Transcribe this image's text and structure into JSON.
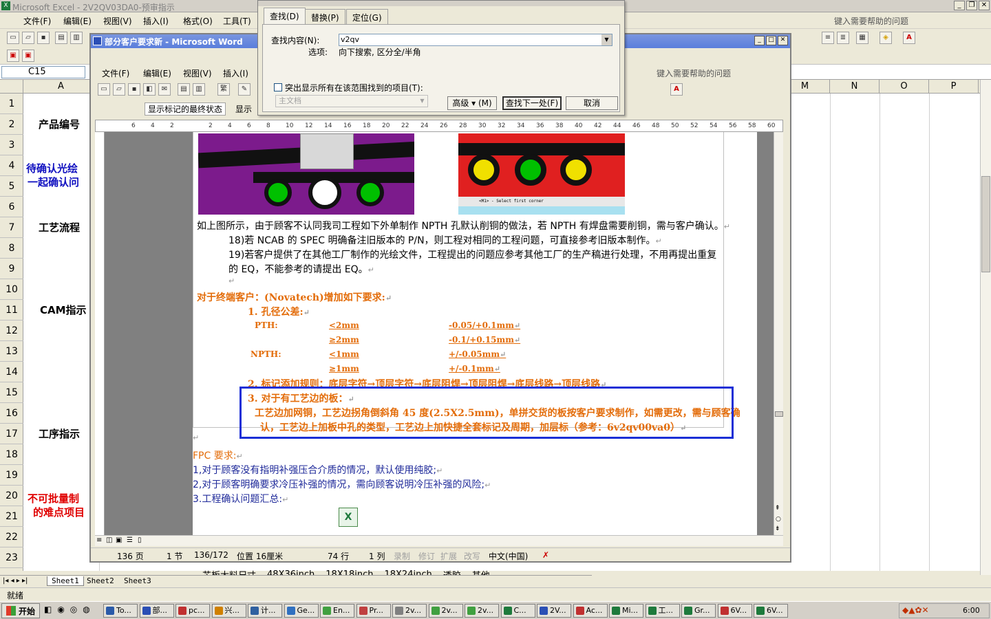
{
  "excel": {
    "title": "Microsoft Excel - 2V2QV03DA0-预审指示",
    "menu": [
      "文件(F)",
      "编辑(E)",
      "视图(V)",
      "插入(I)",
      "格式(O)",
      "工具(T)"
    ],
    "help_placeholder": "键入需要帮助的问题",
    "name_box": "C15",
    "col_a": "A",
    "cols_right": [
      "M",
      "N",
      "O",
      "P"
    ],
    "rows": [
      "1",
      "2",
      "3",
      "4",
      "5",
      "6",
      "7",
      "8",
      "9",
      "10",
      "11",
      "12",
      "13",
      "14",
      "15",
      "16",
      "17",
      "18",
      "19",
      "20",
      "21",
      "22",
      "23"
    ],
    "cells": {
      "product_no": "产品编号",
      "confirm_1": "待确认光绘",
      "confirm_2": "一起确认问",
      "process_flow": "工艺流程",
      "cam": "CAM指示",
      "procedure": "工序指示",
      "hard_1": "不可批量制",
      "hard_2": "的难点项目"
    },
    "bottom_row_text": "芯板大料尺寸",
    "bottom_opts": [
      "48X36inch",
      "18X18inch",
      "18X24inch",
      "透胶",
      "其他"
    ],
    "sheets": [
      "Sheet1",
      "Sheet2",
      "Sheet3"
    ],
    "status": "就绪"
  },
  "word": {
    "title": "部分客户要求新 - Microsoft Word",
    "menu": [
      "文件(F)",
      "编辑(E)",
      "视图(V)",
      "插入(I)"
    ],
    "help_placeholder": "键入需要帮助的问题",
    "markup_select": "显示标记的最终状态",
    "show_label": "显示",
    "ruler": [
      "6",
      "4",
      "2",
      "",
      "2",
      "4",
      "6",
      "8",
      "10",
      "12",
      "14",
      "16",
      "18",
      "20",
      "22",
      "24",
      "26",
      "28",
      "30",
      "32",
      "34",
      "36",
      "38",
      "40",
      "42",
      "44",
      "46",
      "48",
      "50",
      "52",
      "54",
      "56",
      "58",
      "60"
    ],
    "document": {
      "para_npth": "如上图所示，由于顾客不认同我司工程如下外单制作 NPTH 孔默认削铜的做法，若 NPTH 有焊盘需要削铜，需与客户确认。",
      "item18": "18)若 NCAB 的 SPEC 明确备注旧版本的 P/N，则工程对相同的工程问题，可直接参考旧版本制作。",
      "item19a": "19)若客户提供了在其他工厂制作的光绘文件，工程提出的问题应参考其他工厂的生产稿进行处理，不用再提出重复",
      "item19b": "的 EQ，不能参考的请提出 EQ。",
      "novatech": "对于终端客户：(Novatech)增加如下要求:",
      "hole_title": "1.  孔径公差:",
      "pth": "PTH:",
      "npth": "NPTH:",
      "pth_r1": "<2mm",
      "pth_t1": "-0.05/+0.1mm",
      "pth_r2": "≥2mm",
      "pth_t2": "-0.1/+0.15mm",
      "npth_r1": "<1mm",
      "npth_t1": "+/-0.05mm",
      "npth_r2": "≥1mm",
      "npth_t2": "+/-0.1mm",
      "marking": "2.  标记添加规则：底层字符→顶层字符→底层阻焊→顶层阻焊→底层线路→顶层线路",
      "edge_title": "3.  对于有工艺边的板：",
      "edge_l1": "工艺边加网铜，工艺边拐角倒斜角 45 度(2.5X2.5mm)，单拼交货的板按客户要求制作，如需更改，需与顾客确",
      "edge_l2": "认，工艺边上加板中孔的类型，工艺边上加快捷全套标记及周期，加层标（参考：6v2qv00va0）",
      "fpc_title": "FPC 要求:",
      "fpc1": "1,对于顾客没有指明补强压合介质的情况，默认使用纯胶;",
      "fpc2": "2,对于顾客明确要求冷压补强的情况，需向顾客说明冷压补强的风险;",
      "fpc3": "3.工程确认问题汇总:"
    },
    "screenshot_right_caption": "<M1> - Select first corner",
    "status": {
      "page": "136 页",
      "section": "1 节",
      "pages": "136/172",
      "position": "位置 16厘米",
      "line": "74 行",
      "col": "1 列",
      "rec": "录制",
      "trk": "修订",
      "ext": "扩展",
      "ovr": "改写",
      "lang": "中文(中国)"
    }
  },
  "find_dialog": {
    "tabs": [
      "查找(D)",
      "替换(P)",
      "定位(G)"
    ],
    "find_label": "查找内容(N):",
    "find_value": "v2qv",
    "options_label": "选项:",
    "options_value": "向下搜索, 区分全/半角",
    "highlight_label": "突出显示所有在该范围找到的项目(T):",
    "scope": "主文档",
    "btn_more": "高级 ▾ (M)",
    "btn_next": "查找下一处(F)",
    "btn_cancel": "取消"
  },
  "taskbar": {
    "start": "开始",
    "tasks": [
      "To...",
      "部...",
      "pc...",
      "兴...",
      "计...",
      "Ge...",
      "En...",
      "Pr...",
      "2v...",
      "2v...",
      "2v...",
      "C...",
      "2V...",
      "Ac...",
      "Mi...",
      "工...",
      "Gr...",
      "6V...",
      "6V..."
    ],
    "clock": "6:00"
  },
  "colors": {
    "accent_box": "#1a2fd6",
    "doc_orange": "#e36c09",
    "doc_blue": "#1f2a9a",
    "excel_red": "#e00000",
    "excel_blue": "#1010c0"
  }
}
